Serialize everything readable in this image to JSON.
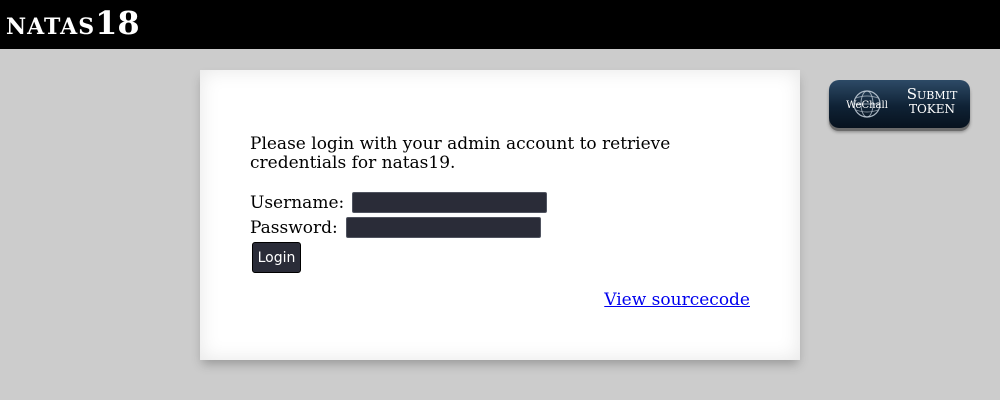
{
  "header": {
    "title_name": "NATAS",
    "title_number": "18"
  },
  "main": {
    "intro_text": "Please login with your admin account to retrieve credentials for natas19.",
    "username_label": "Username:",
    "username_value": "",
    "password_label": "Password:",
    "password_value": "",
    "login_label": "Login",
    "source_link": "View sourcecode"
  },
  "token_button": {
    "logo_text": "WeChall",
    "line1": "Submit",
    "line2": "TOKEN",
    "icon": "globe-icon"
  },
  "colors": {
    "header_bg": "#000000",
    "page_bg": "#cccccc",
    "panel_bg": "#ffffff",
    "field_bg": "#2a2c38",
    "link": "#0000ee",
    "token_bg": "#0f2235"
  }
}
